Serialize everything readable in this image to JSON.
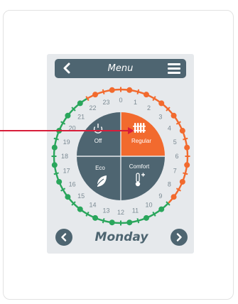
{
  "header": {
    "title": "Menu"
  },
  "modes": [
    {
      "id": "off",
      "label": "Off",
      "icon": "power-icon",
      "color": "#4e6571"
    },
    {
      "id": "regular",
      "label": "Regular",
      "icon": "radiator-icon",
      "color": "#f26a2e"
    },
    {
      "id": "eco",
      "label": "Eco",
      "icon": "leaf-icon",
      "color": "#4e6571"
    },
    {
      "id": "comfort",
      "label": "Comfort",
      "icon": "thermometer-plus-icon",
      "color": "#4e6571"
    }
  ],
  "selected_mode": "regular",
  "hours": [
    "0",
    "1",
    "2",
    "3",
    "4",
    "5",
    "6",
    "7",
    "8",
    "9",
    "10",
    "11",
    "12",
    "13",
    "14",
    "15",
    "16",
    "17",
    "18",
    "19",
    "20",
    "21",
    "22",
    "23"
  ],
  "schedule_colors": {
    "regular": "#f26a2e",
    "eco": "#2aa65c"
  },
  "day": {
    "label": "Monday"
  },
  "colors": {
    "accent": "#f26a2e",
    "primary": "#4e6571",
    "pointer": "#d81e3a"
  }
}
